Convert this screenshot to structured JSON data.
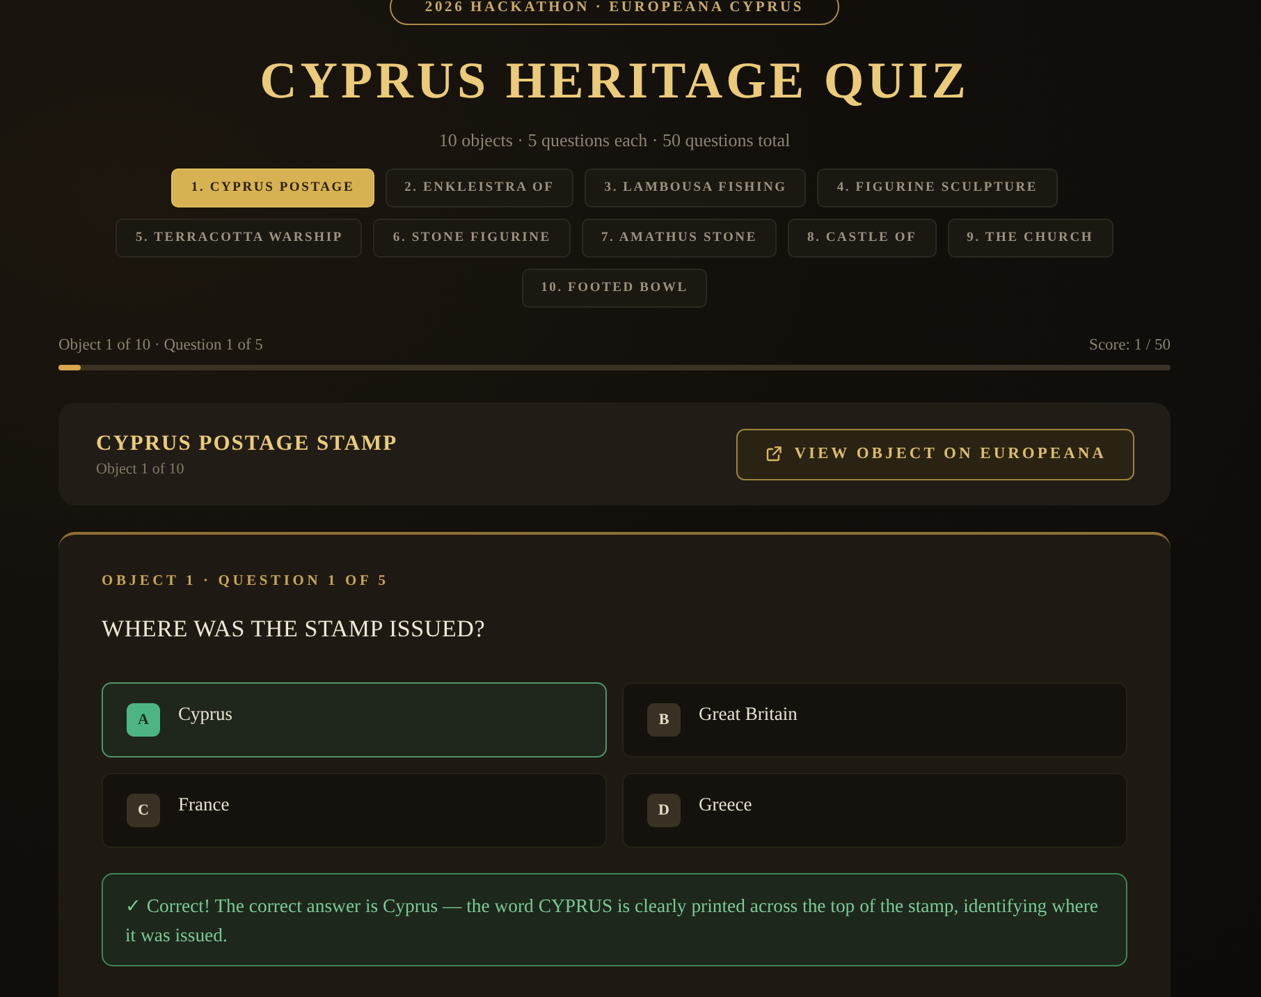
{
  "event_badge": "2026 HACKATHON · EUROPEANA CYPRUS",
  "title": "CYPRUS HERITAGE QUIZ",
  "subtitle": "10 objects · 5 questions each · 50 questions total",
  "object_tabs": [
    {
      "label": "1. CYPRUS POSTAGE",
      "selected": true
    },
    {
      "label": "2. ENKLEISTRA OF",
      "selected": false
    },
    {
      "label": "3. LAMBOUSA FISHING",
      "selected": false
    },
    {
      "label": "4. FIGURINE SCULPTURE",
      "selected": false
    },
    {
      "label": "5. TERRACOTTA WARSHIP",
      "selected": false
    },
    {
      "label": "6. STONE FIGURINE",
      "selected": false
    },
    {
      "label": "7. AMATHUS STONE",
      "selected": false
    },
    {
      "label": "8. CASTLE OF",
      "selected": false
    },
    {
      "label": "9. THE CHURCH",
      "selected": false
    },
    {
      "label": "10. FOOTED BOWL",
      "selected": false
    }
  ],
  "progress": {
    "position": "Object 1 of 10 · Question 1 of 5",
    "score": "Score: 1 / 50",
    "level": 0.02
  },
  "object_card": {
    "title": "CYPRUS POSTAGE STAMP",
    "subtitle": "Object 1 of 10",
    "button": "VIEW OBJECT ON EUROPEANA"
  },
  "question": {
    "eyebrow": "OBJECT 1 · QUESTION 1 OF 5",
    "text": "WHERE WAS THE STAMP ISSUED?",
    "options": [
      {
        "letter": "A",
        "text": "Cyprus",
        "selected": true
      },
      {
        "letter": "B",
        "text": "Great Britain",
        "selected": false
      },
      {
        "letter": "C",
        "text": "France",
        "selected": false
      },
      {
        "letter": "D",
        "text": "Greece",
        "selected": false
      }
    ],
    "feedback": {
      "correct": true,
      "text": "✓ Correct! The correct answer is Cyprus — the word CYPRUS is clearly printed across the top of the stamp, identifying where it was issued."
    }
  }
}
